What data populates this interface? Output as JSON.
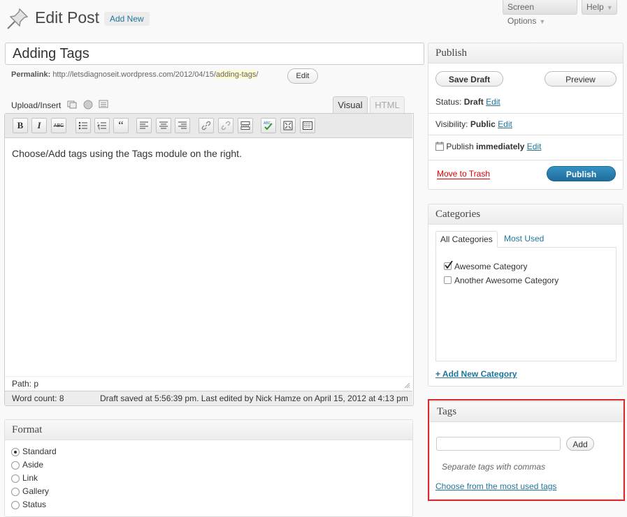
{
  "header": {
    "title": "Edit Post",
    "add_new": "Add New",
    "screen_options": "Screen Options",
    "help": "Help"
  },
  "post": {
    "title": "Adding Tags",
    "permalink_label": "Permalink:",
    "permalink_base": "http://letsdiagnoseit.wordpress.com/2012/04/15/",
    "permalink_slug": "adding-tags",
    "permalink_trail": "/",
    "edit_button": "Edit"
  },
  "editor": {
    "upload_insert": "Upload/Insert",
    "tab_visual": "Visual",
    "tab_html": "HTML",
    "content": "Choose/Add tags using the Tags module on the right.",
    "path_label": "Path:",
    "path_value": "p",
    "word_count_label": "Word count:",
    "word_count": "8",
    "draft_saved": "Draft saved at 5:56:39 pm. Last edited by Nick Hamze on April 15, 2012 at 4:13 pm",
    "toolbar": [
      "bold",
      "italic",
      "strikethrough",
      "bullet-list",
      "numbered-list",
      "blockquote",
      "align-left",
      "align-center",
      "align-right",
      "link",
      "unlink",
      "insert-more",
      "spellcheck",
      "fullscreen",
      "kitchen-sink"
    ]
  },
  "publish": {
    "heading": "Publish",
    "save_draft": "Save Draft",
    "preview": "Preview",
    "status_label": "Status:",
    "status_value": "Draft",
    "visibility_label": "Visibility:",
    "visibility_value": "Public",
    "publish_label": "Publish",
    "publish_value": "immediately",
    "edit": "Edit",
    "move_to_trash": "Move to Trash",
    "publish_button": "Publish"
  },
  "categories": {
    "heading": "Categories",
    "tab_all": "All Categories",
    "tab_most_used": "Most Used",
    "items": [
      {
        "label": "Awesome Category",
        "checked": true
      },
      {
        "label": "Another Awesome Category",
        "checked": false
      }
    ],
    "add_new": "+ Add New Category"
  },
  "tags": {
    "heading": "Tags",
    "input_value": "",
    "add_button": "Add",
    "hint": "Separate tags with commas",
    "choose_link": "Choose from the most used tags"
  },
  "format": {
    "heading": "Format",
    "options": [
      {
        "label": "Standard",
        "selected": true
      },
      {
        "label": "Aside",
        "selected": false
      },
      {
        "label": "Link",
        "selected": false
      },
      {
        "label": "Gallery",
        "selected": false
      },
      {
        "label": "Status",
        "selected": false
      }
    ]
  },
  "colors": {
    "link": "#21759b",
    "highlight_border": "#e0262b",
    "publish_button": "#2a80b0",
    "trash": "#dd0000"
  }
}
